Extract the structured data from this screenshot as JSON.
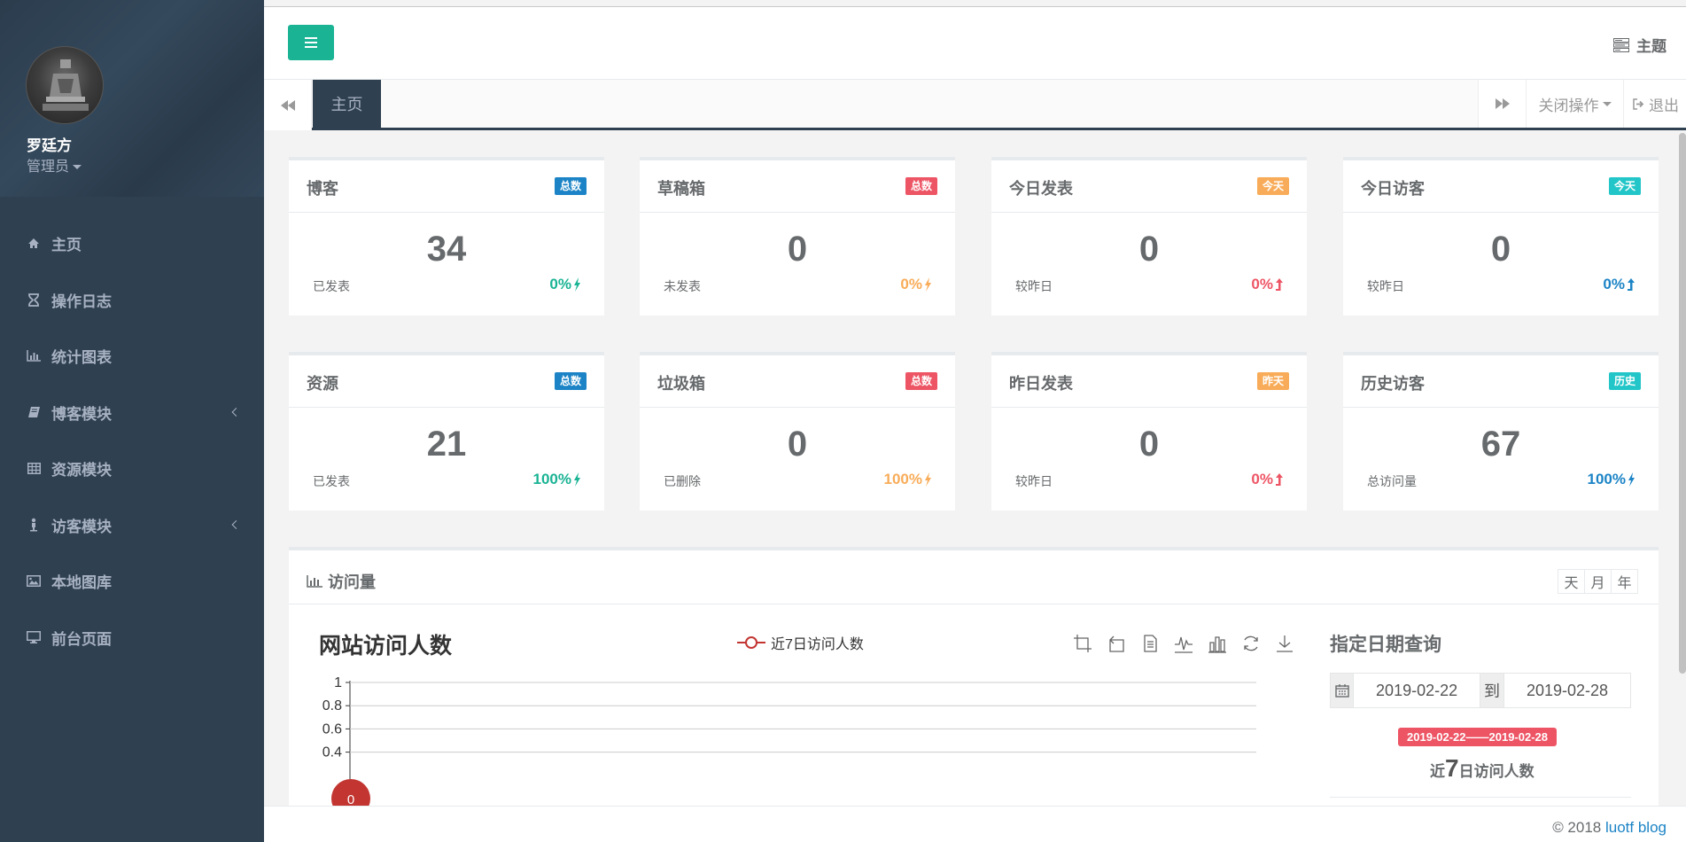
{
  "user": {
    "name": "罗廷方",
    "role": "管理员"
  },
  "nav": [
    {
      "label": "主页",
      "icon": "home-icon",
      "has_arrow": false
    },
    {
      "label": "操作日志",
      "icon": "hourglass-icon",
      "has_arrow": false
    },
    {
      "label": "统计图表",
      "icon": "bar-chart-icon",
      "has_arrow": false
    },
    {
      "label": "博客模块",
      "icon": "book-icon",
      "has_arrow": true
    },
    {
      "label": "资源模块",
      "icon": "table-icon",
      "has_arrow": false
    },
    {
      "label": "访客模块",
      "icon": "user-icon",
      "has_arrow": true
    },
    {
      "label": "本地图库",
      "icon": "picture-icon",
      "has_arrow": false
    },
    {
      "label": "前台页面",
      "icon": "desktop-icon",
      "has_arrow": false
    }
  ],
  "header": {
    "theme_label": "主题"
  },
  "tabs": {
    "home": "主页",
    "close_ops": "关闭操作",
    "exit": "退出"
  },
  "cards": [
    {
      "title": "博客",
      "badge": "总数",
      "badge_color": "#1c84c6",
      "value": "34",
      "sub": "已发表",
      "pct": "0%",
      "pct_color": "#1ab394",
      "pct_icon": "bolt"
    },
    {
      "title": "草稿箱",
      "badge": "总数",
      "badge_color": "#ed5565",
      "value": "0",
      "sub": "未发表",
      "pct": "0%",
      "pct_color": "#f8ac59",
      "pct_icon": "bolt"
    },
    {
      "title": "今日发表",
      "badge": "今天",
      "badge_color": "#f8ac59",
      "value": "0",
      "sub": "较昨日",
      "pct": "0%",
      "pct_color": "#ed5565",
      "pct_icon": "level-up"
    },
    {
      "title": "今日访客",
      "badge": "今天",
      "badge_color": "#23c6c8",
      "value": "0",
      "sub": "较昨日",
      "pct": "0%",
      "pct_color": "#1c84c6",
      "pct_icon": "level-up"
    },
    {
      "title": "资源",
      "badge": "总数",
      "badge_color": "#1c84c6",
      "value": "21",
      "sub": "已发表",
      "pct": "100%",
      "pct_color": "#1ab394",
      "pct_icon": "bolt"
    },
    {
      "title": "垃圾箱",
      "badge": "总数",
      "badge_color": "#ed5565",
      "value": "0",
      "sub": "已删除",
      "pct": "100%",
      "pct_color": "#f8ac59",
      "pct_icon": "bolt"
    },
    {
      "title": "昨日发表",
      "badge": "昨天",
      "badge_color": "#f8ac59",
      "value": "0",
      "sub": "较昨日",
      "pct": "0%",
      "pct_color": "#ed5565",
      "pct_icon": "level-up"
    },
    {
      "title": "历史访客",
      "badge": "历史",
      "badge_color": "#23c6c8",
      "value": "67",
      "sub": "总访问量",
      "pct": "100%",
      "pct_color": "#1c84c6",
      "pct_icon": "bolt"
    }
  ],
  "visits": {
    "panel_title": "访问量",
    "range_buttons": [
      "天",
      "月",
      "年"
    ],
    "chart_title": "网站访问人数",
    "legend": "近7日访问人数",
    "query_title": "指定日期查询",
    "date_from": "2019-02-22",
    "date_to_label": "到",
    "date_to": "2019-02-28",
    "range_label": "2019-02-22——2019-02-28",
    "recent_prefix": "近",
    "recent_num": "7",
    "recent_suffix": "日访问人数"
  },
  "chart_data": {
    "type": "line",
    "series": [
      {
        "name": "近7日访问人数",
        "values": [
          0
        ]
      }
    ],
    "yticks": [
      "1",
      "0.8",
      "0.6",
      "0.4"
    ],
    "ylim": [
      0,
      1
    ],
    "point_label": "0",
    "colors": {
      "line": "#c23531"
    }
  },
  "footer": {
    "copyright": "© 2018",
    "link": "luotf blog"
  }
}
